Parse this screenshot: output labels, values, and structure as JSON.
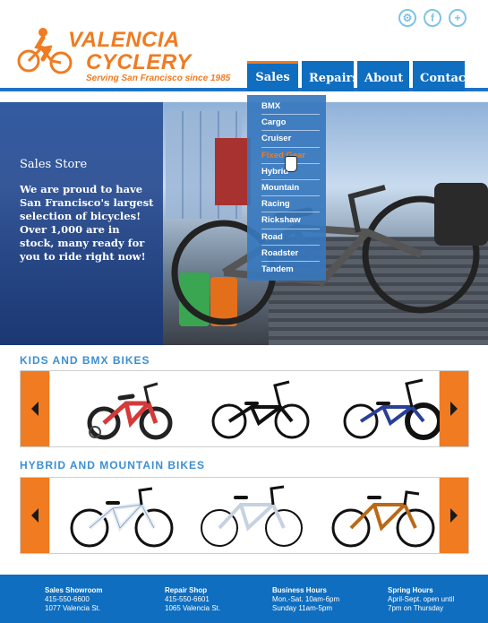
{
  "header": {
    "logo_line1": "VALENCIA",
    "logo_line2": "CYCLERY",
    "tagline": "Serving San Francisco since 1985",
    "social": [
      {
        "icon": "gear-icon",
        "glyph": "⚙"
      },
      {
        "icon": "facebook-icon",
        "glyph": "f"
      },
      {
        "icon": "plus-icon",
        "glyph": "+"
      }
    ]
  },
  "nav": {
    "tabs": [
      {
        "label": "Sales",
        "active": true
      },
      {
        "label": "Repairs",
        "active": false
      },
      {
        "label": "About",
        "active": false
      },
      {
        "label": "Contact",
        "active": false
      }
    ]
  },
  "dropdown": {
    "items": [
      "BMX",
      "Cargo",
      "Cruiser",
      "Fixed Gear",
      "Hybrid",
      "Mountain",
      "Racing",
      "Rickshaw",
      "Road",
      "Roadster",
      "Tandem"
    ],
    "highlighted": "Fixed Gear"
  },
  "hero": {
    "title": "Sales Store",
    "text": "We are proud to have San Francisco's largest selection of bicycles! Over 1,000 are in stock, many ready for you to ride right now!"
  },
  "sections": [
    {
      "title": "KIDS AND BMX BIKES",
      "bikes": [
        "kids-bike-red",
        "bmx-bike-black",
        "bmx-bike-blue"
      ]
    },
    {
      "title": "HYBRID AND MOUNTAIN BIKES",
      "bikes": [
        "hybrid-bike-white",
        "hybrid-bike-silver",
        "fixie-bike-orange"
      ]
    }
  ],
  "footer": {
    "columns": [
      {
        "title": "Sales Showroom",
        "line1": "415-550-6600",
        "line2": "1077 Valencia St."
      },
      {
        "title": "Repair Shop",
        "line1": "415-550-6601",
        "line2": "1065 Valencia St."
      },
      {
        "title": "Business Hours",
        "line1": "Mon.-Sat. 10am-6pm",
        "line2": "Sunday 11am-5pm"
      },
      {
        "title": "Spring Hours",
        "line1": "April-Sept. open until",
        "line2": "7pm on Thursday"
      }
    ]
  },
  "colors": {
    "brand_orange": "#f07b21",
    "brand_blue": "#0f6ebf",
    "section_blue": "#3c8fd2"
  }
}
